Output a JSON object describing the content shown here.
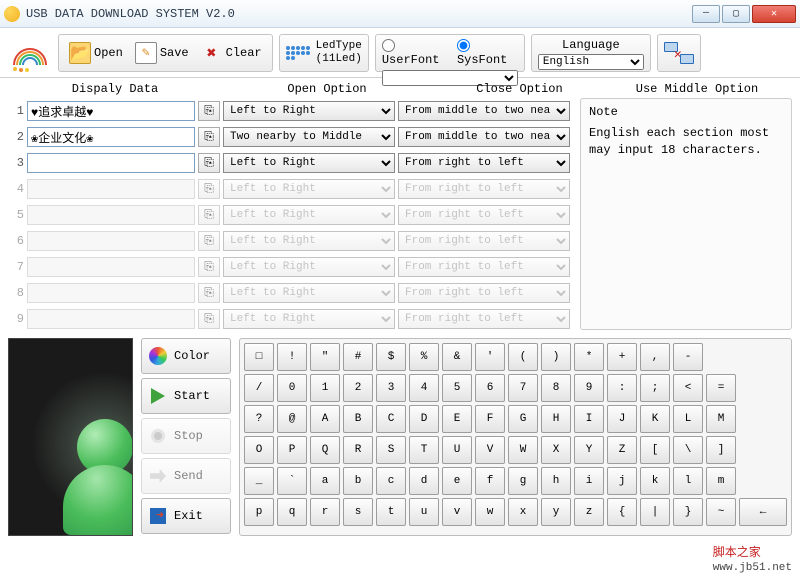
{
  "window": {
    "title": "USB DATA DOWNLOAD SYSTEM V2.0"
  },
  "toolbar": {
    "open": "Open",
    "save": "Save",
    "clear": "Clear",
    "ledtype": "LedType\n(11Led)"
  },
  "font": {
    "user": "UserFont",
    "sys": "SysFont",
    "selected": "sys",
    "dropdown": ""
  },
  "language": {
    "label": "Language",
    "value": "English"
  },
  "headers": {
    "display": "Dispaly Data",
    "open": "Open Option",
    "close": "Close Option",
    "middle": "Use Middle Option"
  },
  "rows": [
    {
      "n": "1",
      "text": "♥追求卓越♥",
      "open": "Left to Right",
      "close": "From middle to two nea",
      "enabled": true
    },
    {
      "n": "2",
      "text": "❀企业文化❀",
      "open": "Two nearby to Middle",
      "close": "From middle to two nea",
      "enabled": true
    },
    {
      "n": "3",
      "text": "",
      "open": "Left to Right",
      "close": "From right to left",
      "enabled": true
    },
    {
      "n": "4",
      "text": "",
      "open": "Left to Right",
      "close": "From right to left",
      "enabled": false
    },
    {
      "n": "5",
      "text": "",
      "open": "Left to Right",
      "close": "From right to left",
      "enabled": false
    },
    {
      "n": "6",
      "text": "",
      "open": "Left to Right",
      "close": "From right to left",
      "enabled": false
    },
    {
      "n": "7",
      "text": "",
      "open": "Left to Right",
      "close": "From right to left",
      "enabled": false
    },
    {
      "n": "8",
      "text": "",
      "open": "Left to Right",
      "close": "From right to left",
      "enabled": false
    },
    {
      "n": "9",
      "text": "",
      "open": "Left to Right",
      "close": "From right to left",
      "enabled": false
    }
  ],
  "note": {
    "title": "Note",
    "body": "English each section most may input 18 characters."
  },
  "sidebuttons": {
    "color": "Color",
    "start": "Start",
    "stop": "Stop",
    "send": "Send",
    "exit": "Exit"
  },
  "keyboard": [
    [
      "□",
      "!",
      "\"",
      "#",
      "$",
      "%",
      "&",
      "'",
      "(",
      ")",
      "*",
      "+",
      ",",
      "-"
    ],
    [
      "/",
      "0",
      "1",
      "2",
      "3",
      "4",
      "5",
      "6",
      "7",
      "8",
      "9",
      ":",
      ";",
      "<",
      "="
    ],
    [
      "?",
      "@",
      "A",
      "B",
      "C",
      "D",
      "E",
      "F",
      "G",
      "H",
      "I",
      "J",
      "K",
      "L",
      "M"
    ],
    [
      "O",
      "P",
      "Q",
      "R",
      "S",
      "T",
      "U",
      "V",
      "W",
      "X",
      "Y",
      "Z",
      "[",
      "\\",
      "]"
    ],
    [
      "_",
      "`",
      "a",
      "b",
      "c",
      "d",
      "e",
      "f",
      "g",
      "h",
      "i",
      "j",
      "k",
      "l",
      "m"
    ],
    [
      "p",
      "q",
      "r",
      "s",
      "t",
      "u",
      "v",
      "w",
      "x",
      "y",
      "z",
      "{",
      "|",
      "}",
      "~",
      "←"
    ]
  ],
  "watermark": {
    "text": "脚本之家",
    "url": "www.jb51.net"
  }
}
